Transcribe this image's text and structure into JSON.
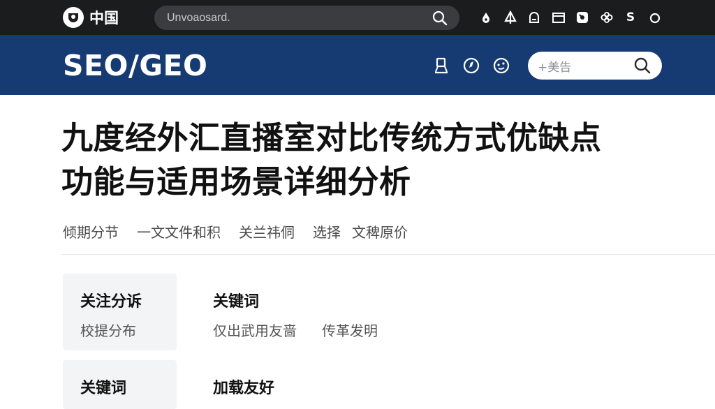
{
  "topbar": {
    "brand": "中国",
    "search_value": "Unvoaosard.",
    "icons": [
      "drop-icon",
      "tree-icon",
      "chat-icon",
      "window-icon",
      "settings-icon",
      "flower-icon",
      "s-icon",
      "ring-icon"
    ],
    "s_glyph": "S"
  },
  "header": {
    "site_title": "SEO/GEO",
    "icons": [
      "user-icon",
      "compass-icon",
      "dashboard-icon"
    ],
    "search_placeholder": "+美告"
  },
  "article": {
    "title_line1": "九度经外汇直播室对比传统方式优缺点",
    "title_line2": "功能与适用场景详细分析",
    "meta": [
      "倾期分节",
      "一文文件和积",
      "关兰祎侗",
      "选择",
      "文稗原价"
    ]
  },
  "info": [
    {
      "label_title": "关注分诉",
      "label_sub": "校提分布",
      "content_title": "关键词",
      "content_values": [
        "仅出武用友啬",
        "传革发明"
      ]
    },
    {
      "label_title": "关键词",
      "label_sub": "",
      "content_title": "加载友好",
      "content_values": []
    }
  ],
  "colors": {
    "topbar_bg": "#1b1c1e",
    "header_bg": "#163a72",
    "search_bg": "#3b3c40",
    "label_bg": "#f3f4f5"
  }
}
